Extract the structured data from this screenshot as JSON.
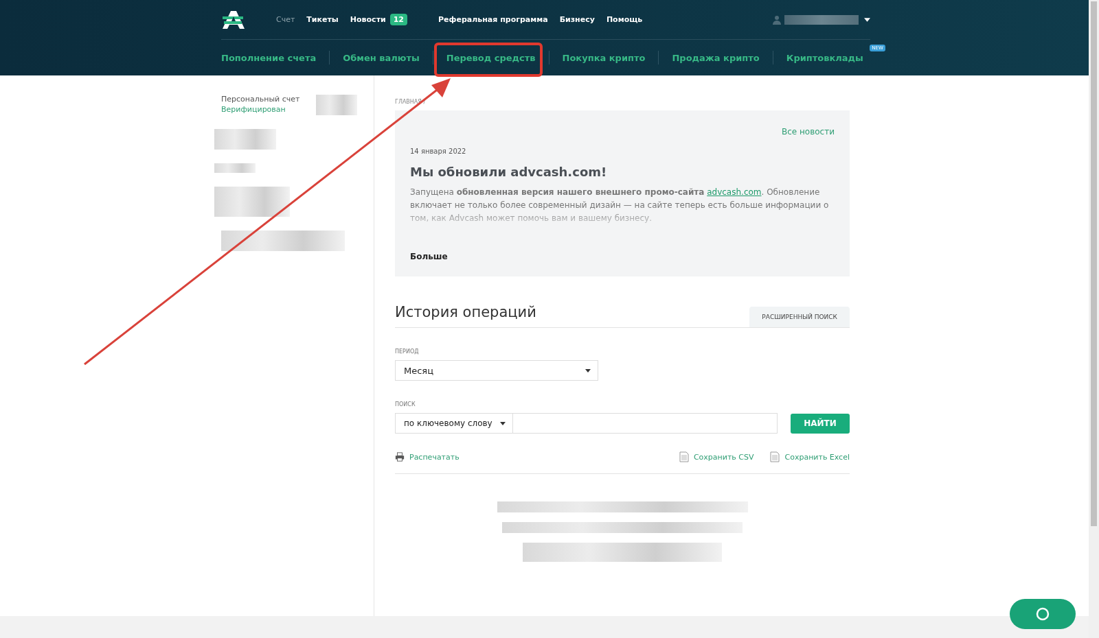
{
  "header": {
    "top_nav": [
      {
        "label": "Счет",
        "selected": true
      },
      {
        "label": "Тикеты",
        "selected": false
      },
      {
        "label": "Новости",
        "selected": false,
        "badge": "12"
      },
      {
        "label": "Реферальная программа",
        "selected": false
      },
      {
        "label": "Бизнесу",
        "selected": false
      },
      {
        "label": "Помощь",
        "selected": false
      }
    ],
    "main_nav": [
      {
        "label": "Пополнение счета"
      },
      {
        "label": "Обмен валюты"
      },
      {
        "label": "Перевод средств"
      },
      {
        "label": "Покупка крипто"
      },
      {
        "label": "Продажа крипто"
      },
      {
        "label": "Криптовклады",
        "badge": "NEW"
      }
    ]
  },
  "sidebar": {
    "account_label": "Персональный счет",
    "status": "Верифицирован"
  },
  "breadcrumb": "ГЛАВНАЯ /",
  "news": {
    "all_link": "Все новости",
    "date": "14 января 2022",
    "title": "Мы обновили advcash.com!",
    "body_start": "Запущена **обновленная версия нашего внешнего промо-сайта**",
    "body_link": "advcash.com",
    "body_end": ". Обновление включает не только более современный дизайн — на сайте теперь есть больше информации о том, как Advcash может помочь вам и вашему бизнесу.",
    "more": "Больше"
  },
  "history": {
    "title": "История операций",
    "advanced_search": "РАСШИРЕННЫЙ ПОИСК",
    "period_label": "ПЕРИОД",
    "period_value": "Месяц",
    "search_label": "ПОИСК",
    "search_type": "по ключевому слову",
    "find_button": "НАЙТИ",
    "print": "Распечатать",
    "save_csv": "Сохранить CSV",
    "save_excel": "Сохранить Excel"
  }
}
